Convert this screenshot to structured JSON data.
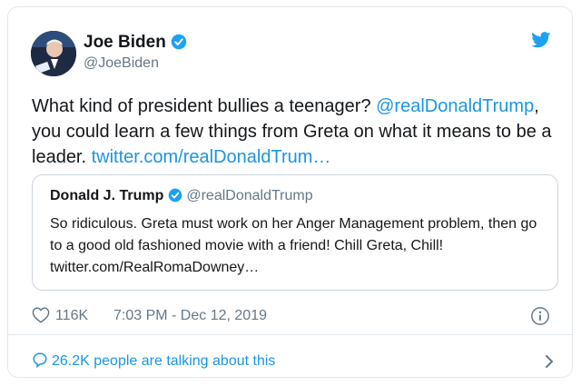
{
  "tweet": {
    "author_name": "Joe Biden",
    "author_handle": "@JoeBiden",
    "text_before": "What kind of president bullies a teenager? ",
    "mention": "@realDonaldTrump",
    "text_middle": ", you could learn a few things from Greta on what it means to be a leader. ",
    "link": "twitter.com/realDonaldTrum…",
    "likes": "116K",
    "timestamp": "7:03 PM - Dec 12, 2019",
    "talking": "26.2K people are talking about this"
  },
  "quoted": {
    "author_name": "Donald J. Trump",
    "author_handle": "@realDonaldTrump",
    "text": "So ridiculous. Greta must work on her Anger Management problem, then go to a good old fashioned movie with a friend! Chill Greta, Chill!",
    "link": "twitter.com/RealRomaDowney…"
  },
  "icons": {
    "verified": "verified-badge-icon",
    "bird": "twitter-bird-icon",
    "heart": "heart-icon",
    "info": "info-icon",
    "bubble": "speech-bubble-icon",
    "chevron": "chevron-right-icon"
  },
  "colors": {
    "link": "#1b95e0",
    "text": "#14171a",
    "muted": "#657786",
    "border": "#e1e8ed"
  }
}
